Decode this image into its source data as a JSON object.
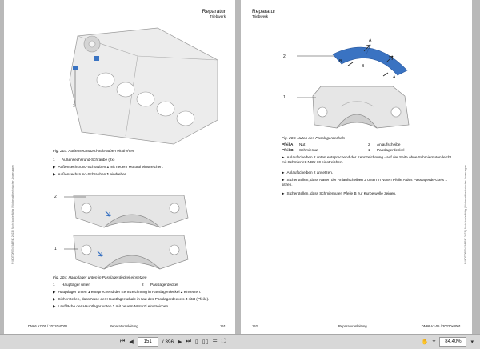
{
  "left_page": {
    "header_title": "Reparatur",
    "header_sub": "Triebwerk",
    "side_text": "© MOTORENFABRIK 2023 | Nicht kopierfähig | Vorbehalt technischer Änderungen",
    "fig203": {
      "callout": "1",
      "caption": "Fig. 203: Außensechsrund-Schrauben eindrehen",
      "legend_num": "1",
      "legend_text": "Außensechsrund-Schraube (2x)",
      "steps": [
        {
          "pre": "Außensechsrund-Schrauben ",
          "bold": "1",
          "post": " mit neuem Motoröl einstreichen."
        },
        {
          "pre": "Außensechsrund-Schrauben ",
          "bold": "1",
          "post": " eindrehen."
        }
      ]
    },
    "fig204": {
      "callout2": "2",
      "callout1": "1",
      "caption": "Fig. 204: Hauptlager unten in Passlagerdeckel einsetzen",
      "legend": [
        {
          "num": "1",
          "text": "Hauptlager unten"
        },
        {
          "num": "2",
          "text": "Passlagerdeckel"
        }
      ],
      "steps": [
        {
          "pre": "Hauptlager unten ",
          "bold": "1",
          "post": " entsprechend der Kennzeichnung in Passlagerdeckel ",
          "bold2": "2",
          "post2": " einsetzen."
        },
        {
          "pre": "Sicherstellen, dass Nase der Hauptlagerschale in Nut des Passlagerdeckels ",
          "bold": "2",
          "post": " sitzt (Pfeile).",
          "bold2": "",
          "post2": ""
        },
        {
          "pre": "Lauffläche der Hauptlager unten ",
          "bold": "1",
          "post": " mit neuem Motoröl einstreichen.",
          "bold2": "",
          "post2": ""
        }
      ]
    },
    "footer_left": "DN66 A7-05 / 20220x0001",
    "footer_mid": "Reparaturanleitung",
    "footer_right": "151"
  },
  "right_page": {
    "header_title": "Reparatur",
    "header_sub": "Triebwerk",
    "side_text": "© MOTORENFABRIK 2023 | Nicht kopierfähig | Vorbehalt technischer Änderungen",
    "fig205": {
      "callout_A_top": "A",
      "callout_A_bottom": "A",
      "callout_B_left": "B",
      "callout_B_right": "B",
      "callout2": "2",
      "callout1": "1",
      "caption": "Fig. 205: Nuten des Passlagerdeckels",
      "legend": [
        {
          "key": "Pfeil A",
          "text": "Nut",
          "num": "2",
          "desc": "Anlaufscheibe"
        },
        {
          "key": "Pfeil B",
          "text": "Schmiernut",
          "num": "1",
          "desc": "Passlagerdeckel"
        }
      ],
      "steps": [
        {
          "text": "Anlaufscheiben 2 unten entsprechend der Kennzeichnung - auf der Seite ohne Schmiernuten leicht mit Schmierfett NBU 30 einstreichen."
        },
        {
          "text": "Anlaufscheiben 2 ansetzen."
        },
        {
          "text": "Sicherstellen, dass Nasen der Anlaufscheiben 2 unten in Nuten Pfeile A des Passlagerde-ckels 1 sitzen."
        },
        {
          "text": "Sicherstellen, dass Schmiernuten Pfeile B zur Kurbelwelle zeigen."
        }
      ]
    },
    "footer_left": "152",
    "footer_mid": "Reparaturanleitung",
    "footer_right": "DN66 A7-05 / 20220x0001"
  },
  "status_bar": {
    "page_current": "151",
    "page_total": "/ 396",
    "zoom": "84,40%"
  }
}
